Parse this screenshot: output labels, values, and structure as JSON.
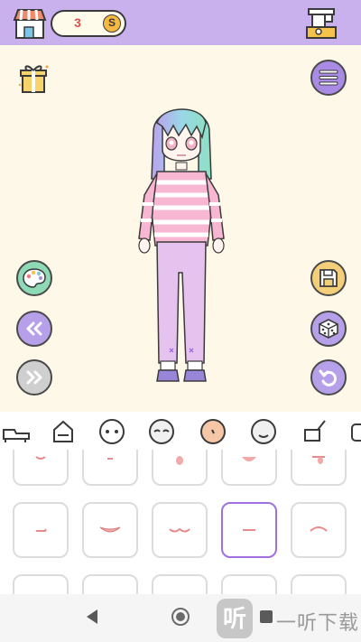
{
  "top_bar": {
    "coins": "3",
    "coin_symbol": "S"
  },
  "icons": {
    "shop": "shop-icon",
    "gacha": "gacha-machine-icon",
    "gift": "gift-icon",
    "menu": "menu-icon",
    "palette": "palette-icon",
    "save": "save-icon",
    "prev": "double-chevron-left-icon",
    "next": "double-chevron-right-icon",
    "dice": "dice-icon",
    "undo": "undo-icon"
  },
  "category_tabs": [
    "shoes",
    "bag",
    "face",
    "eyes",
    "nose",
    "mouth",
    "accessory",
    "extra"
  ],
  "selected_mouth_index": 8,
  "colors": {
    "top_bar": "#c9b1ee",
    "stage": "#fdf8e8",
    "accent": "#a070e0",
    "mouth": "#e88a8a"
  },
  "watermark": {
    "icon_text": "听",
    "text": "一听下载"
  }
}
